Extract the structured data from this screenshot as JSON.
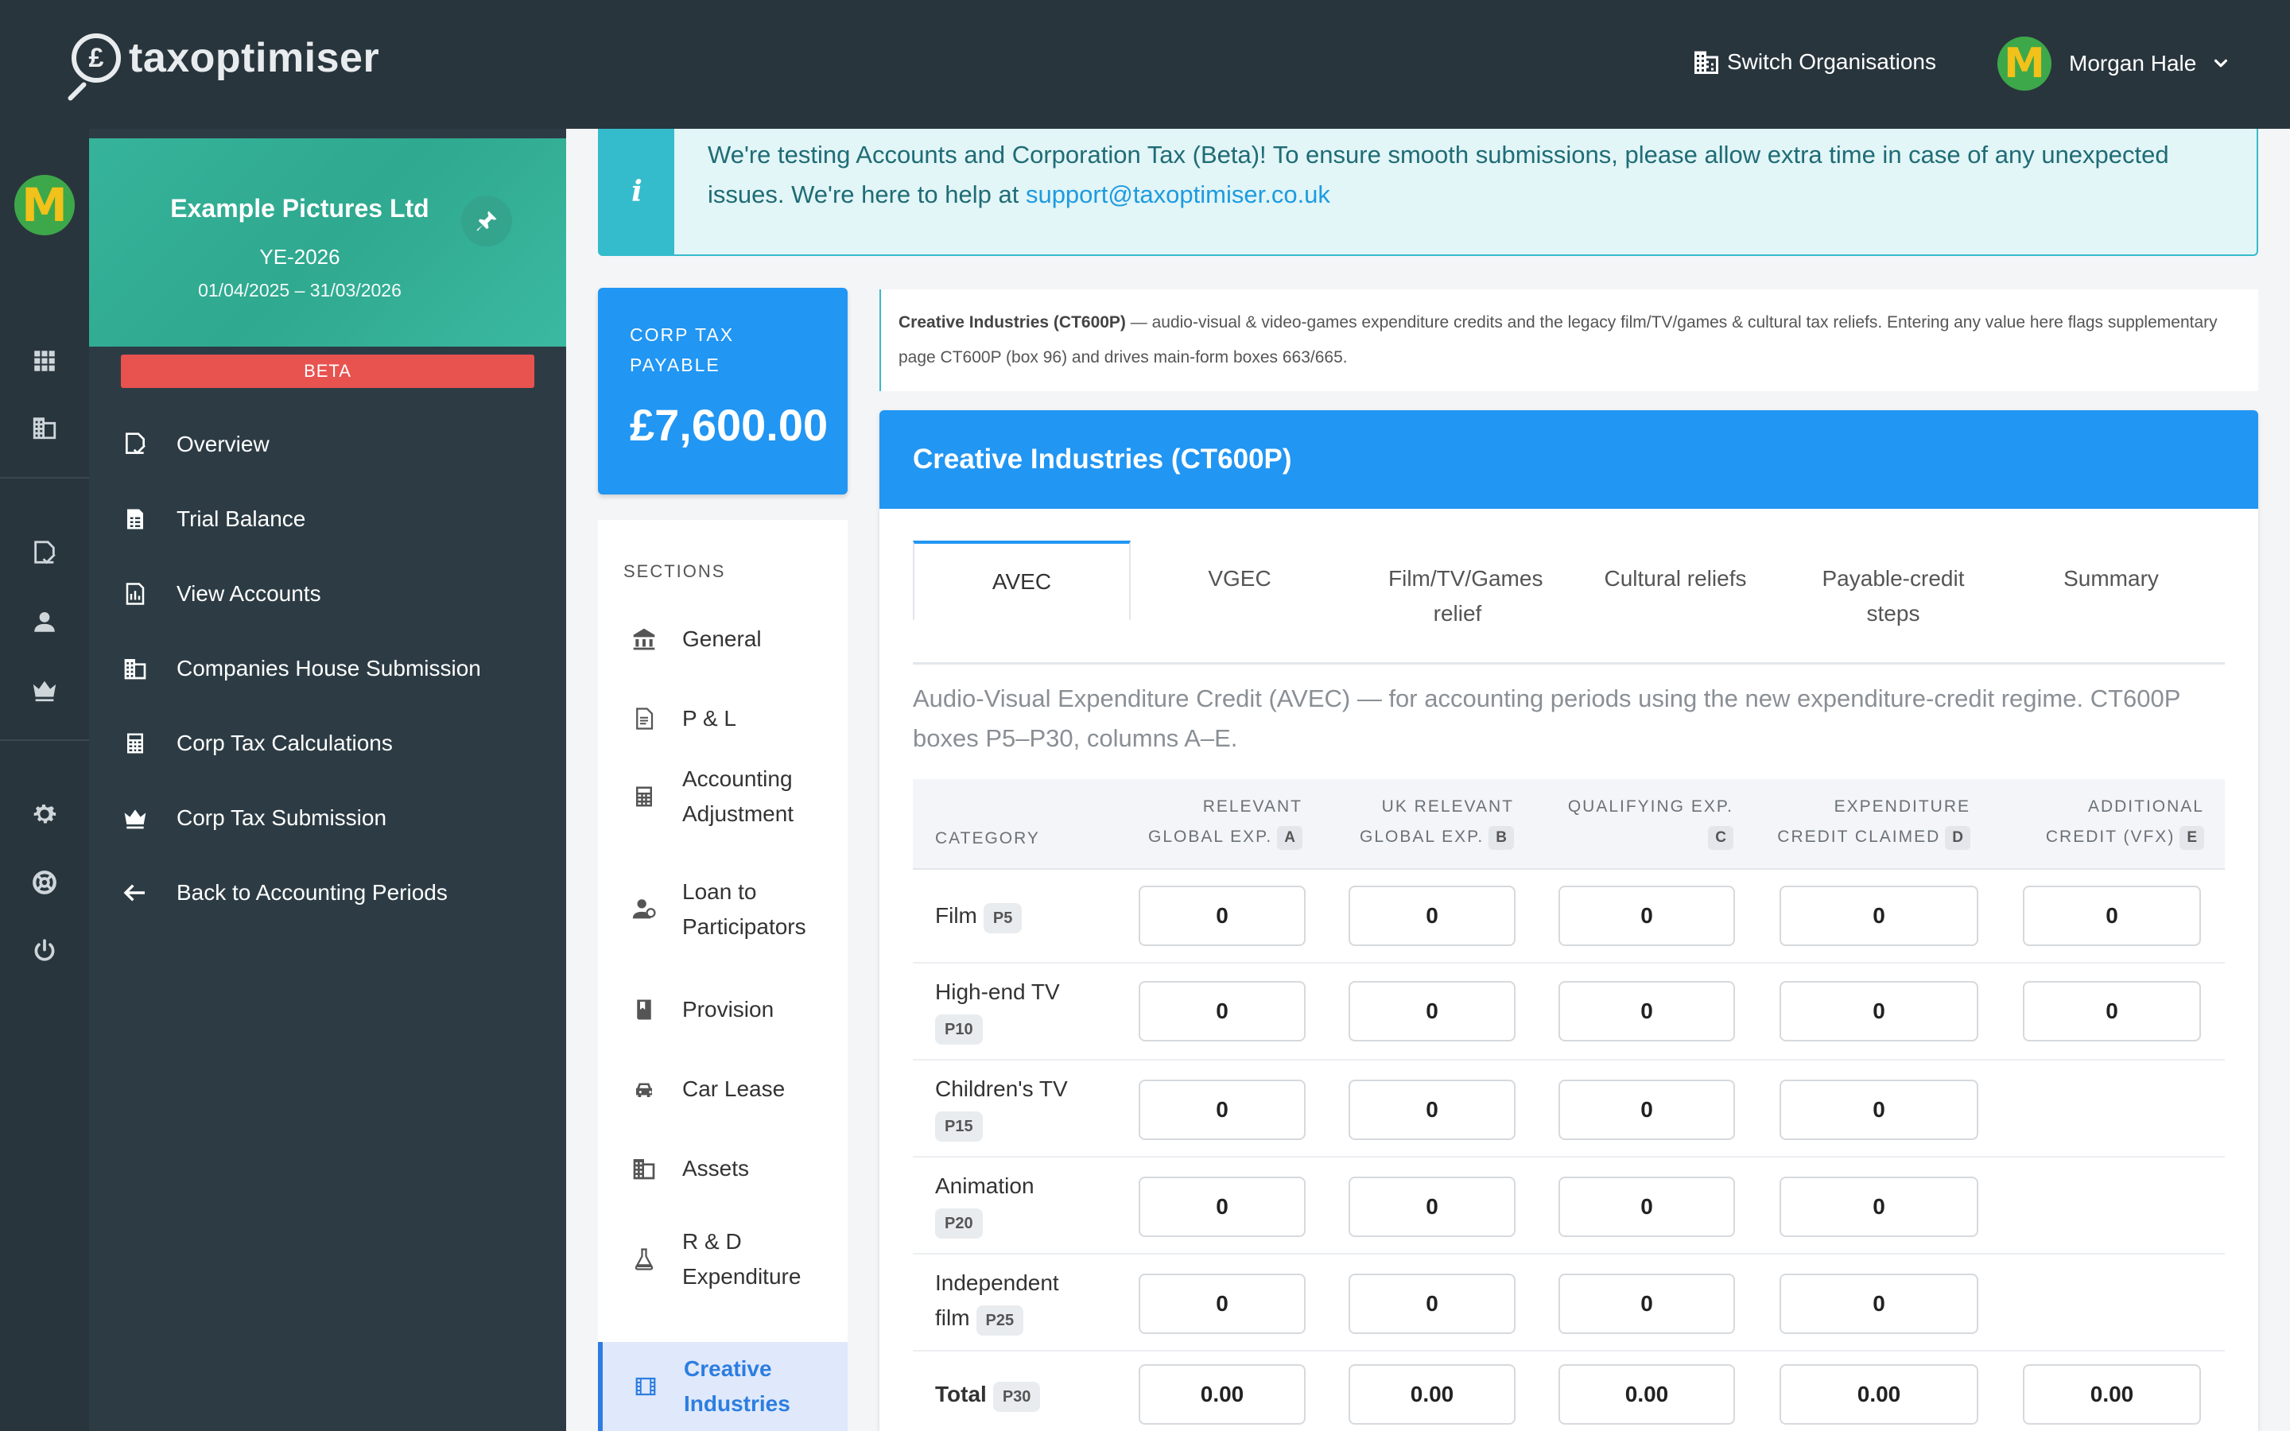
{
  "app": {
    "logo_text": "taxoptimiser",
    "logo_symbol": "£",
    "switch_org_label": "Switch Organisations",
    "user_name": "Morgan Hale",
    "avatar_letter": "M"
  },
  "company": {
    "name": "Example Pictures Ltd",
    "year_end": "YE-2026",
    "period": "01/04/2025 – 31/03/2026",
    "beta_label": "BETA"
  },
  "sidebar_nav": [
    {
      "label": "Overview",
      "icon": "document-check-icon"
    },
    {
      "label": "Trial Balance",
      "icon": "spreadsheet-icon"
    },
    {
      "label": "View Accounts",
      "icon": "report-chart-icon"
    },
    {
      "label": "Companies House Submission",
      "icon": "building-icon"
    },
    {
      "label": "Corp Tax Calculations",
      "icon": "calculator-icon"
    },
    {
      "label": "Corp Tax Submission",
      "icon": "crown-icon"
    },
    {
      "label": "Back to Accounting Periods",
      "icon": "arrow-left-icon"
    }
  ],
  "banner": {
    "text": "We're testing Accounts and Corporation Tax (Beta)! To ensure smooth submissions, please allow extra time in case of any unexpected issues. We're here to help at ",
    "link": "support@taxoptimiser.co.uk"
  },
  "tax_card": {
    "label": "CORP TAX PAYABLE",
    "value": "£7,600.00"
  },
  "sections": {
    "title": "SECTIONS",
    "items": [
      {
        "label": "General",
        "icon": "bank-icon"
      },
      {
        "label": "P & L",
        "icon": "document-icon"
      },
      {
        "label": "Accounting Adjustment",
        "icon": "calculator-icon"
      },
      {
        "label": "Loan to Participators",
        "icon": "person-loan-icon"
      },
      {
        "label": "Provision",
        "icon": "book-icon"
      },
      {
        "label": "Car Lease",
        "icon": "car-icon"
      },
      {
        "label": "Assets",
        "icon": "building-icon"
      },
      {
        "label": "R & D Expenditure",
        "icon": "flask-icon"
      },
      {
        "label": "Creative Industries",
        "icon": "film-icon",
        "active": true
      }
    ]
  },
  "description": {
    "bold": "Creative Industries (CT600P)",
    "text": " — audio-visual & video-games expenditure credits and the legacy film/TV/games & cultural tax reliefs. Entering any value here flags supplementary page CT600P (box 96) and drives main-form boxes 663/665."
  },
  "panel": {
    "title": "Creative Industries (CT600P)",
    "tabs": [
      "AVEC",
      "VGEC",
      "Film/TV/Games relief",
      "Cultural reliefs",
      "Payable-credit steps",
      "Summary"
    ],
    "active_tab": "AVEC",
    "avec_description": "Audio-Visual Expenditure Credit (AVEC) — for accounting periods using the new expenditure-credit regime. CT600P boxes P5–P30, columns A–E."
  },
  "grid": {
    "category_header": "CATEGORY",
    "columns": [
      {
        "line1": "RELEVANT",
        "line2": "GLOBAL EXP.",
        "badge": "A"
      },
      {
        "line1": "UK RELEVANT",
        "line2": "GLOBAL EXP.",
        "badge": "B"
      },
      {
        "line1": "QUALIFYING EXP.",
        "line2": "",
        "badge": "C"
      },
      {
        "line1": "EXPENDITURE",
        "line2": "CREDIT CLAIMED",
        "badge": "D"
      },
      {
        "line1": "ADDITIONAL",
        "line2": "CREDIT (VFX)",
        "badge": "E"
      }
    ],
    "rows": [
      {
        "label": "Film",
        "badge": "P5",
        "values": [
          "0",
          "0",
          "0",
          "0",
          "0"
        ]
      },
      {
        "label": "High-end TV",
        "badge": "P10",
        "values": [
          "0",
          "0",
          "0",
          "0",
          "0"
        ]
      },
      {
        "label": "Children's TV",
        "badge": "P15",
        "values": [
          "0",
          "0",
          "0",
          "0"
        ]
      },
      {
        "label": "Animation",
        "badge": "P20",
        "values": [
          "0",
          "0",
          "0",
          "0"
        ]
      },
      {
        "label": "Independent film",
        "badge": "P25",
        "values": [
          "0",
          "0",
          "0",
          "0"
        ]
      },
      {
        "label": "Total",
        "badge": "P30",
        "values": [
          "0.00",
          "0.00",
          "0.00",
          "0.00",
          "0.00"
        ]
      }
    ]
  }
}
